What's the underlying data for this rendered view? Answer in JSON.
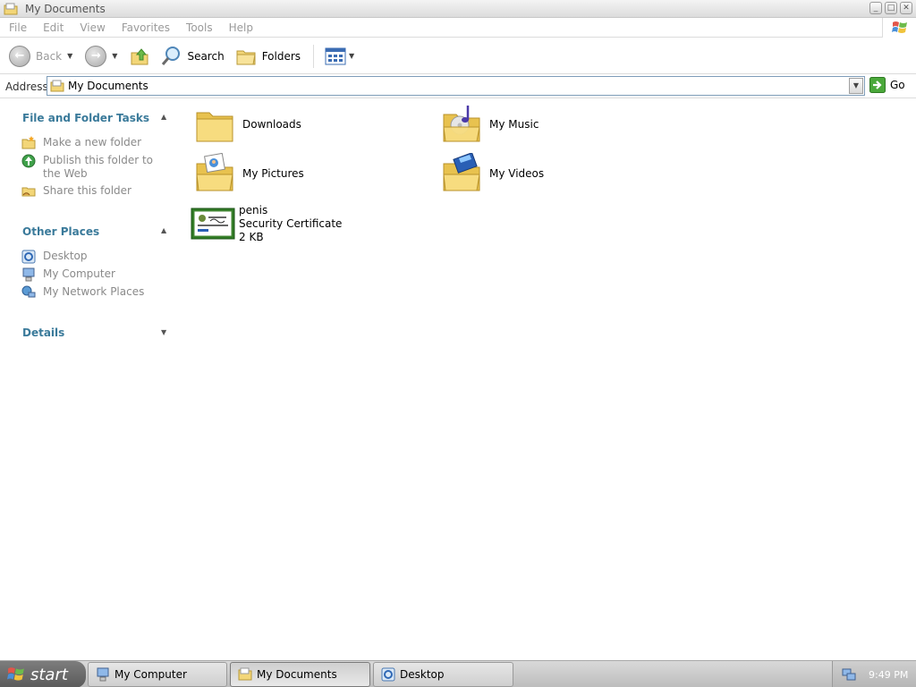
{
  "window": {
    "title": "My Documents"
  },
  "menu": [
    "File",
    "Edit",
    "View",
    "Favorites",
    "Tools",
    "Help"
  ],
  "toolbar": {
    "back_label": "Back",
    "search_label": "Search",
    "folders_label": "Folders"
  },
  "address": {
    "label": "Address",
    "value": "My Documents",
    "go_label": "Go"
  },
  "taskpane": {
    "file_tasks": {
      "title": "File and Folder Tasks",
      "items": [
        {
          "label": "Make a new folder",
          "icon": "new-folder-icon"
        },
        {
          "label": "Publish this folder to the Web",
          "icon": "publish-web-icon"
        },
        {
          "label": "Share this folder",
          "icon": "share-folder-icon"
        }
      ]
    },
    "other_places": {
      "title": "Other Places",
      "items": [
        {
          "label": "Desktop",
          "icon": "desktop-icon"
        },
        {
          "label": "My Computer",
          "icon": "my-computer-icon"
        },
        {
          "label": "My Network Places",
          "icon": "network-places-icon"
        }
      ]
    },
    "details": {
      "title": "Details"
    }
  },
  "files": [
    {
      "name": "Downloads",
      "icon": "folder-icon"
    },
    {
      "name": "My Music",
      "icon": "music-folder-icon"
    },
    {
      "name": "My Pictures",
      "icon": "pictures-folder-icon"
    },
    {
      "name": "My Videos",
      "icon": "videos-folder-icon"
    },
    {
      "name": "penis",
      "type": "Security Certificate",
      "size": "2 KB",
      "icon": "certificate-icon"
    }
  ],
  "taskbar": {
    "start_label": "start",
    "tasks": [
      {
        "label": "My Computer",
        "icon": "my-computer-icon"
      },
      {
        "label": "My Documents",
        "icon": "folder-icon",
        "active": true
      },
      {
        "label": "Desktop",
        "icon": "desktop-icon"
      }
    ],
    "clock": "9:49 PM"
  },
  "colors": {
    "section_heading": "#3a7a9a",
    "disabled_text": "#9a9a9a",
    "folder": "#f5d76e"
  }
}
